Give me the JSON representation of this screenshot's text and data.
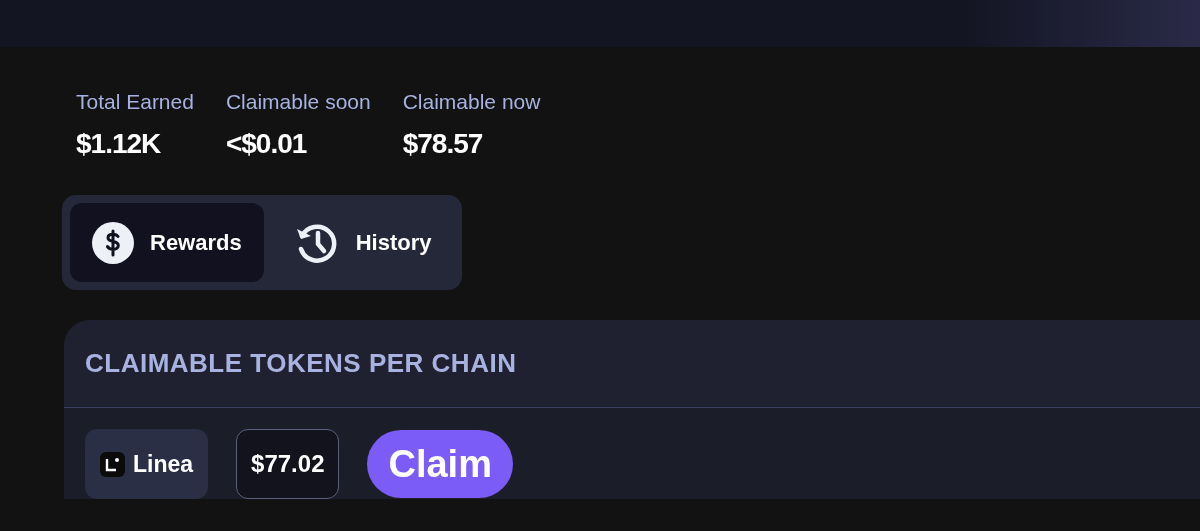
{
  "stats": [
    {
      "label": "Total Earned",
      "value": "$1.12K"
    },
    {
      "label": "Claimable soon",
      "value": "<$0.01"
    },
    {
      "label": "Claimable now",
      "value": "$78.57"
    }
  ],
  "tabs": [
    {
      "label": "Rewards",
      "kind": "rewards",
      "selected": true
    },
    {
      "label": "History",
      "kind": "history",
      "selected": false
    }
  ],
  "card": {
    "title": "CLAIMABLE TOKENS PER CHAIN",
    "rows": [
      {
        "chain": "Linea",
        "amount": "$77.02",
        "button": "Claim"
      }
    ]
  }
}
